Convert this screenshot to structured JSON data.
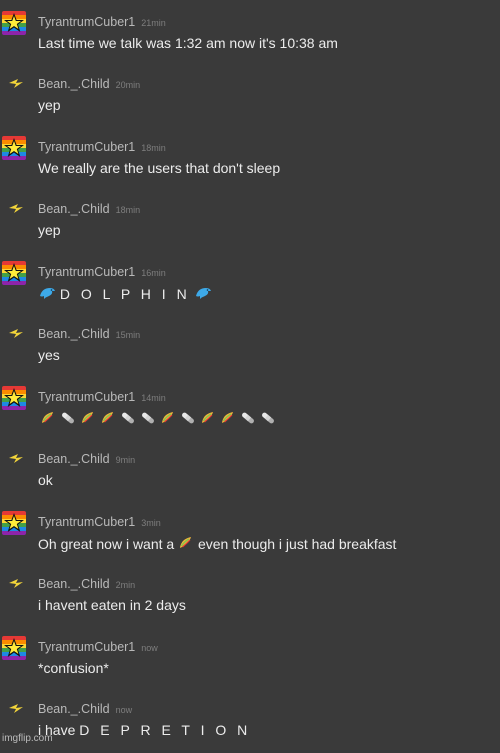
{
  "colors": {
    "background": "#3a3a3a",
    "username": "#b9b9b9",
    "timestamp": "#7e7e7e",
    "message": "#ececec"
  },
  "icons": {
    "tyrantrum_avatar": "rainbow-star-avatar-icon",
    "bean_avatar": "lightning-avatar-icon",
    "dolphin": "dolphin-emoji-icon",
    "taco": "taco-emoji-icon",
    "pill": "pill-emoji-icon"
  },
  "messages": [
    {
      "user": "TyrantrumCuber1",
      "time": "21min",
      "text": "Last time we talk was 1:32 am now it's 10:38 am"
    },
    {
      "user": "Bean._.Child",
      "time": "20min",
      "text": "yep"
    },
    {
      "user": "TyrantrumCuber1",
      "time": "18min",
      "text": "We really are the users that don't sleep"
    },
    {
      "user": "Bean._.Child",
      "time": "18min",
      "text": "yep"
    },
    {
      "user": "TyrantrumCuber1",
      "time": "16min",
      "text": "D O L P H I N"
    },
    {
      "user": "Bean._.Child",
      "time": "15min",
      "text": "yes"
    },
    {
      "user": "TyrantrumCuber1",
      "time": "14min",
      "text": ""
    },
    {
      "user": "Bean._.Child",
      "time": "9min",
      "text": "ok"
    },
    {
      "user": "TyrantrumCuber1",
      "time": "3min",
      "text_before": "Oh great now i want a",
      "text_after": "even though i just had breakfast"
    },
    {
      "user": "Bean._.Child",
      "time": "2min",
      "text": "i havent eaten in 2 days"
    },
    {
      "user": "TyrantrumCuber1",
      "time": "now",
      "text": "*confusion*"
    },
    {
      "user": "Bean._.Child",
      "time": "now",
      "text_before": "i have",
      "text_spaced": "D E P R E T I O N"
    }
  ],
  "emoji_sequence": [
    "taco",
    "pill",
    "taco",
    "taco",
    "pill",
    "pill",
    "taco",
    "pill",
    "taco",
    "taco",
    "pill",
    "pill"
  ],
  "watermark": "imgflip.com"
}
